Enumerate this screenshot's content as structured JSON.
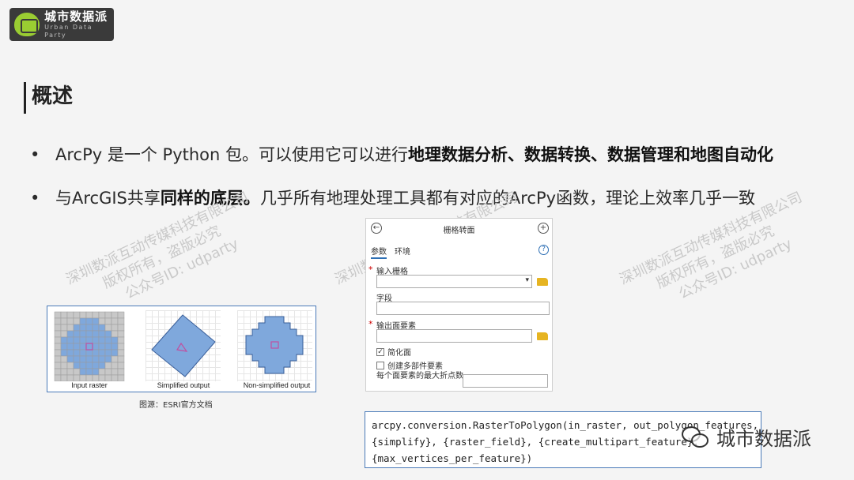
{
  "logo": {
    "name": "城市数据派",
    "tagline": "Urban Data Party"
  },
  "heading": "概述",
  "bullets": [
    {
      "plain": "ArcPy 是一个 Python 包。可以使用它可以进行",
      "bold": "地理数据分析、数据转换、数据管理和地图自动化",
      "tail": ""
    },
    {
      "plain": "与ArcGIS共享",
      "bold": "同样的底层。",
      "tail": "几乎所有地理处理工具都有对应的ArcPy函数，理论上效率几乎一致"
    }
  ],
  "bullet_symbol": "•",
  "watermark_lines": [
    "深圳数派互动传媒科技有限公司",
    "版权所有，盗版必究",
    "公众号ID: udparty"
  ],
  "figure": {
    "panels": [
      "Input raster",
      "Simplified output",
      "Non-simplified output"
    ],
    "caption": "图源：ESRI官方文档",
    "colors": {
      "cell": "#c8c8c8",
      "fill": "#7fa8dc",
      "outline": "#3a5f9a",
      "marker": "#c050a0"
    }
  },
  "dialog": {
    "title": "栅格转面",
    "tabs": [
      "参数",
      "环境"
    ],
    "back_icon": "back-arrow-icon",
    "add_icon": "plus-icon",
    "help_icon": "help-icon",
    "fields": {
      "input_raster": "输入栅格",
      "field": "字段",
      "output_features": "输出面要素",
      "simplify": "简化面",
      "multipart": "创建多部件要素",
      "max_vertices": "每个面要素的最大折点数"
    },
    "simplify_checked": true,
    "multipart_checked": false
  },
  "code_lines": [
    "arcpy.conversion.RasterToPolygon(in_raster, out_polygon_features,",
    "{simplify}, {raster_field}, {create_multipart_feature},",
    "{max_vertices_per_feature})"
  ],
  "badge": "城市数据派"
}
